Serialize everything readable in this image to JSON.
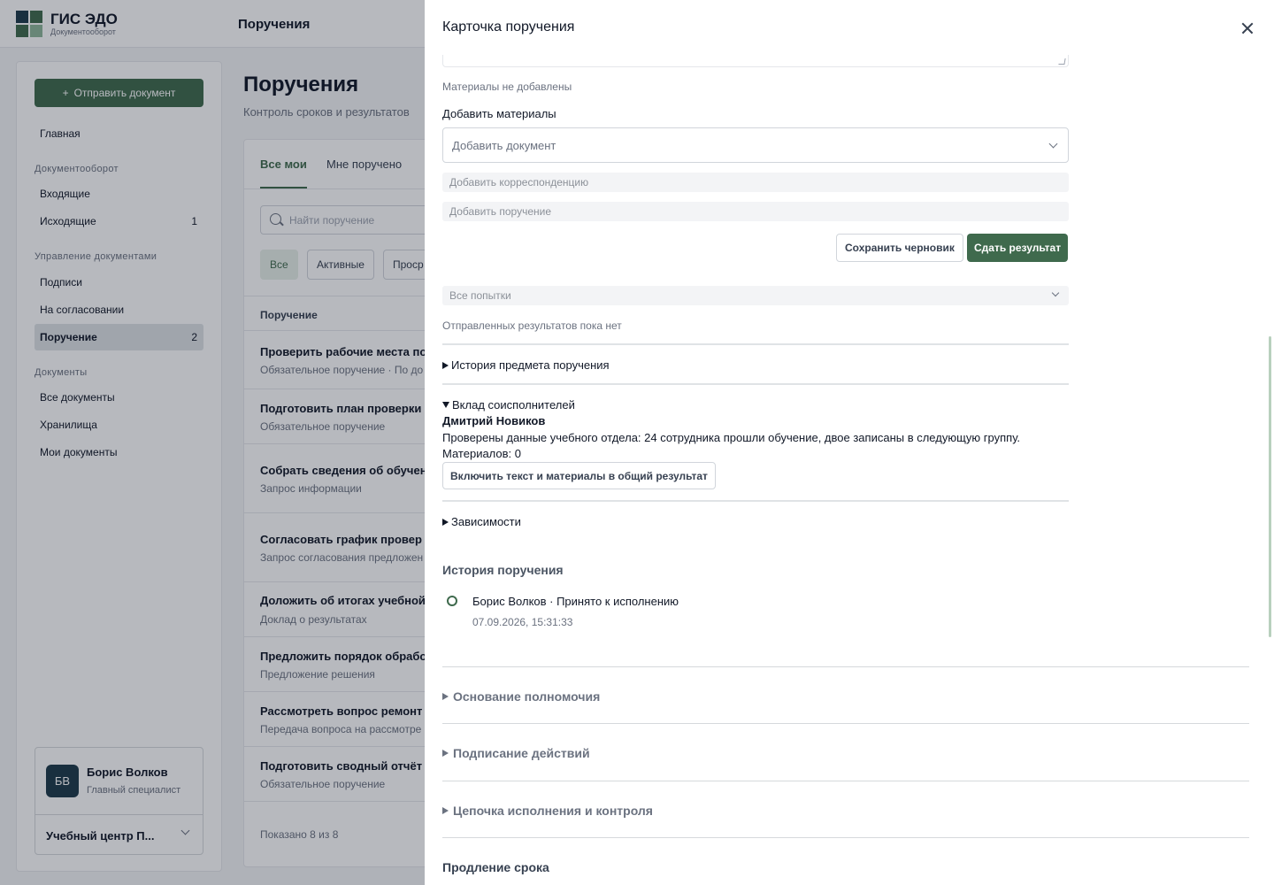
{
  "app": {
    "brand_title": "ГИС ЭДО",
    "brand_subtitle": "Документооборот",
    "top_title": "Поручения"
  },
  "sidebar": {
    "send_button": "Отправить документ",
    "home": "Главная",
    "group_docflow": "Документооборот",
    "incoming": "Входящие",
    "outgoing": "Исходящие",
    "outgoing_count": "1",
    "group_manage": "Управление документами",
    "signatures": "Подписи",
    "approval": "На согласовании",
    "assignment": "Поручение",
    "assignment_count": "2",
    "group_docs": "Документы",
    "all_docs": "Все документы",
    "storage": "Хранилища",
    "my_docs": "Мои документы",
    "user_initials": "БВ",
    "user_name": "Борис Волков",
    "user_role": "Главный специалист",
    "org_name": "Учебный центр П..."
  },
  "main": {
    "title": "Поручения",
    "subtitle": "Контроль сроков и результатов",
    "tabs": [
      "Все мои",
      "Мне поручено"
    ],
    "search_placeholder": "Найти поручение",
    "filters": [
      "Все",
      "Активные",
      "Проср"
    ],
    "column_header": "Поручение",
    "rows": [
      {
        "title": "Проверить рабочие места по",
        "sub": "Обязательное поручение · По до"
      },
      {
        "title": "Подготовить план проверки",
        "sub": "Обязательное поручение"
      },
      {
        "title": "Собрать сведения об обучен",
        "sub": "Запрос информации"
      },
      {
        "title": "Согласовать график провер",
        "sub": "Запрос согласования предложен"
      },
      {
        "title": "Доложить об итогах учебной",
        "sub": "Доклад о результатах"
      },
      {
        "title": "Предложить порядок обрабо",
        "sub": "Предложение решения"
      },
      {
        "title": "Рассмотреть вопрос ремонт",
        "sub": "Передача вопроса на рассмотре"
      },
      {
        "title": "Подготовить сводный отчёт",
        "sub": "Обязательное поручение"
      }
    ],
    "shown": "Показано 8 из 8"
  },
  "drawer": {
    "title": "Карточка поручения",
    "no_materials": "Материалы не добавлены",
    "add_materials_label": "Добавить материалы",
    "add_document_placeholder": "Добавить документ",
    "add_correspondence_placeholder": "Добавить корреспонденцию",
    "add_assignment_placeholder": "Добавить поручение",
    "save_draft": "Сохранить черновик",
    "submit_result": "Сдать результат",
    "attempts_select": "Все попытки",
    "no_results": "Отправленных результатов пока нет",
    "subject_history": "История предмета поручения",
    "coexecutors": "Вклад соисполнителей",
    "coexec_name": "Дмитрий Новиков",
    "coexec_text": "Проверены данные учебного отдела: 24 сотрудника прошли обучение, двое записаны в следующую группу.",
    "coexec_materials": "Материалов: 0",
    "include_button": "Включить текст и материалы в общий результат",
    "dependencies": "Зависимости",
    "history_title": "История поручения",
    "history_event": "Борис Волков · Принято к исполнению",
    "history_time": "07.09.2026, 15:31:33",
    "basis": "Основание полномочия",
    "signing": "Подписание действий",
    "chain": "Цепочка исполнения и контроля",
    "extension": "Продление срока"
  }
}
